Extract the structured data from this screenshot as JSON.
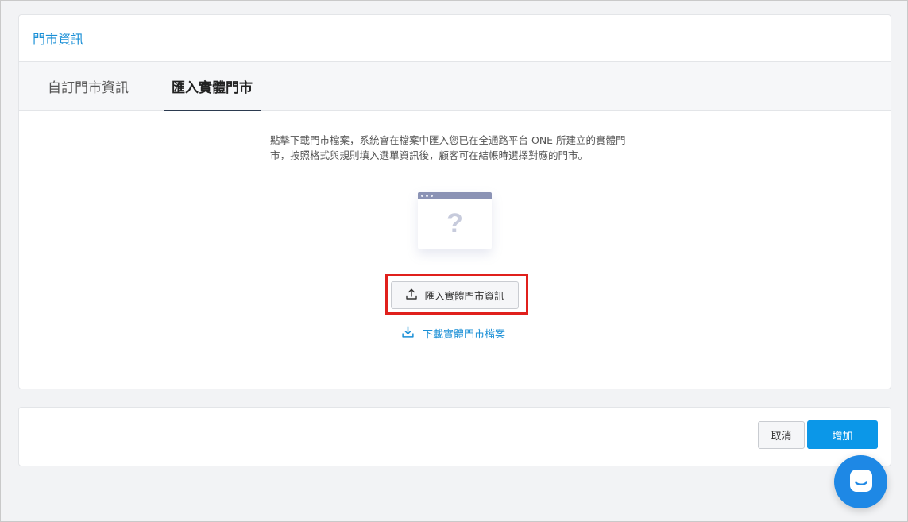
{
  "card": {
    "title": "門市資訊"
  },
  "tabs": [
    {
      "label": "自訂門市資訊",
      "active": false
    },
    {
      "label": "匯入實體門市",
      "active": true
    }
  ],
  "import": {
    "description": "點擊下載門市檔案，系統會在檔案中匯入您已在全通路平台 ONE 所建立的實體門市，按照格式與規則填入選單資訊後，顧客可在結帳時選擇對應的門市。",
    "import_button_label": "匯入實體門市資訊",
    "download_link_label": "下載實體門市檔案"
  },
  "footer": {
    "cancel_label": "取消",
    "add_label": "增加"
  },
  "icons": {
    "upload": "upload-icon",
    "download": "download-icon",
    "chat": "chat-icon",
    "placeholder": "question-mark-icon"
  },
  "colors": {
    "accent": "#1a8fd6",
    "primary_button": "#0b97e8",
    "highlight": "#e0201c",
    "chat_launcher": "#1e88e5"
  }
}
